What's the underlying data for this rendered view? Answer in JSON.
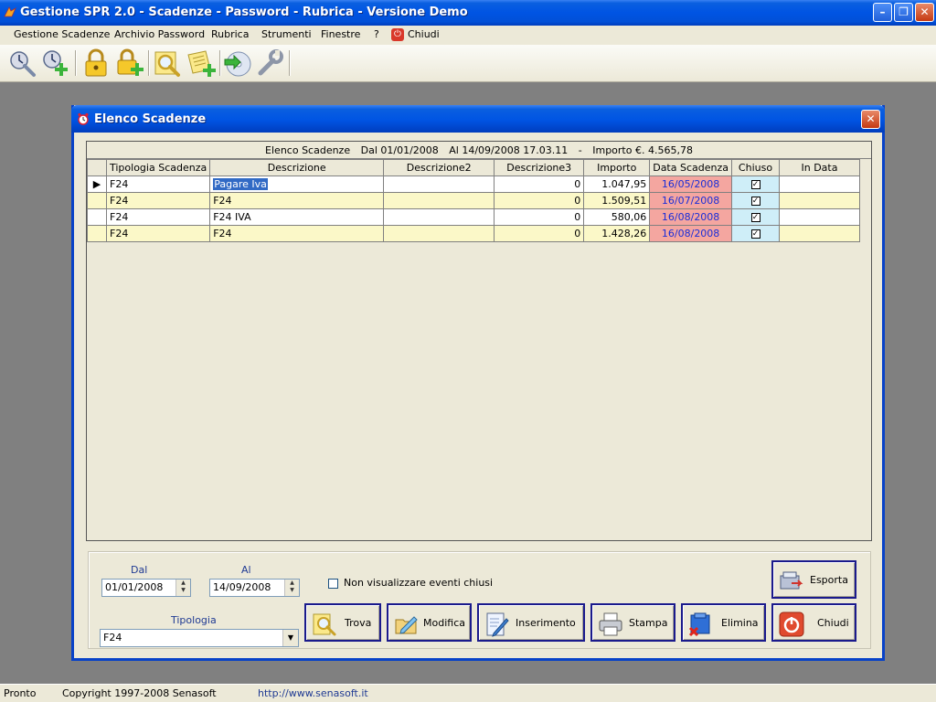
{
  "window": {
    "title": "Gestione SPR 2.0 - Scadenze - Password - Rubrica - Versione Demo"
  },
  "menu": [
    "Gestione Scadenze",
    "Archivio Password",
    "Rubrica",
    "Strumenti",
    "Finestre",
    "?",
    "Chiudi"
  ],
  "toolbar": {
    "icons": [
      "scadenze-icon",
      "nuova-scadenza-icon",
      "password-icon",
      "nuova-password-icon",
      "rubrica-cerca-icon",
      "rubrica-nuovo-icon",
      "backup-icon",
      "strumenti-icon"
    ]
  },
  "child": {
    "title": "Elenco Scadenze"
  },
  "grid": {
    "caption": {
      "label": "Elenco Scadenze",
      "dal": "Dal 01/01/2008",
      "al": "Al 14/09/2008 17.03.11",
      "sep": "-",
      "importo": "Importo €. 4.565,78"
    },
    "columns": [
      "Tipologia Scadenza",
      "Descrizione",
      "Descrizione2",
      "Descrizione3",
      "Importo",
      "Data Scadenza",
      "Chiuso",
      "In Data"
    ],
    "rows": [
      {
        "tipologia": "F24",
        "descrizione": "Pagare Iva",
        "descrizione2": "",
        "descrizione3": "0",
        "importo": "1.047,95",
        "data": "16/05/2008",
        "chiuso": "✓",
        "in_data": "",
        "current": "▶"
      },
      {
        "tipologia": "F24",
        "descrizione": "F24",
        "descrizione2": "",
        "descrizione3": "0",
        "importo": "1.509,51",
        "data": "16/07/2008",
        "chiuso": "✓",
        "in_data": "",
        "current": ""
      },
      {
        "tipologia": "F24",
        "descrizione": "F24 IVA",
        "descrizione2": "",
        "descrizione3": "0",
        "importo": "580,06",
        "data": "16/08/2008",
        "chiuso": "✓",
        "in_data": "",
        "current": ""
      },
      {
        "tipologia": "F24",
        "descrizione": "F24",
        "descrizione2": "",
        "descrizione3": "0",
        "importo": "1.428,26",
        "data": "16/08/2008",
        "chiuso": "✓",
        "in_data": "",
        "current": ""
      }
    ]
  },
  "filters": {
    "dal_label": "Dal",
    "dal_value": "01/01/2008",
    "al_label": "Al",
    "al_value": "14/09/2008",
    "non_visualizzare_label": "Non visualizzare eventi chiusi",
    "tipologia_label": "Tipologia",
    "tipologia_value": "F24"
  },
  "buttons": {
    "esporta": "Esporta",
    "trova": "Trova",
    "modifica": "Modifica",
    "inserimento": "Inserimento",
    "stampa": "Stampa",
    "elimina": "Elimina",
    "chiudi": "Chiudi"
  },
  "status": {
    "state": "Pronto",
    "copyright": "Copyright 1997-2008 Senasoft",
    "url": "http://www.senasoft.it"
  },
  "colors": {
    "titlebar": "#0054e3",
    "row_alt": "#fbf8c8",
    "date_cell": "#f4a6a0",
    "chiuso_cell": "#cfeef8",
    "button_border": "#1a1a8c"
  }
}
